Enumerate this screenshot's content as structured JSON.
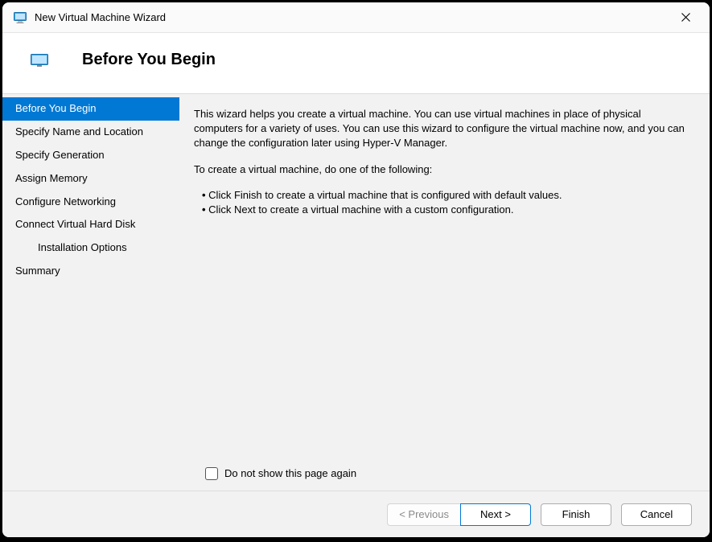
{
  "window": {
    "title": "New Virtual Machine Wizard"
  },
  "header": {
    "title": "Before You Begin"
  },
  "sidebar": {
    "steps": [
      {
        "label": "Before You Begin",
        "active": true,
        "indent": false
      },
      {
        "label": "Specify Name and Location",
        "active": false,
        "indent": false
      },
      {
        "label": "Specify Generation",
        "active": false,
        "indent": false
      },
      {
        "label": "Assign Memory",
        "active": false,
        "indent": false
      },
      {
        "label": "Configure Networking",
        "active": false,
        "indent": false
      },
      {
        "label": "Connect Virtual Hard Disk",
        "active": false,
        "indent": false
      },
      {
        "label": "Installation Options",
        "active": false,
        "indent": true
      },
      {
        "label": "Summary",
        "active": false,
        "indent": false
      }
    ]
  },
  "content": {
    "intro": "This wizard helps you create a virtual machine. You can use virtual machines in place of physical computers for a variety of uses. You can use this wizard to configure the virtual machine now, and you can change the configuration later using Hyper-V Manager.",
    "subintro": "To create a virtual machine, do one of the following:",
    "bullets": [
      "Click Finish to create a virtual machine that is configured with default values.",
      "Click Next to create a virtual machine with a custom configuration."
    ],
    "checkbox_label": "Do not show this page again"
  },
  "footer": {
    "previous": "< Previous",
    "next": "Next >",
    "finish": "Finish",
    "cancel": "Cancel"
  }
}
